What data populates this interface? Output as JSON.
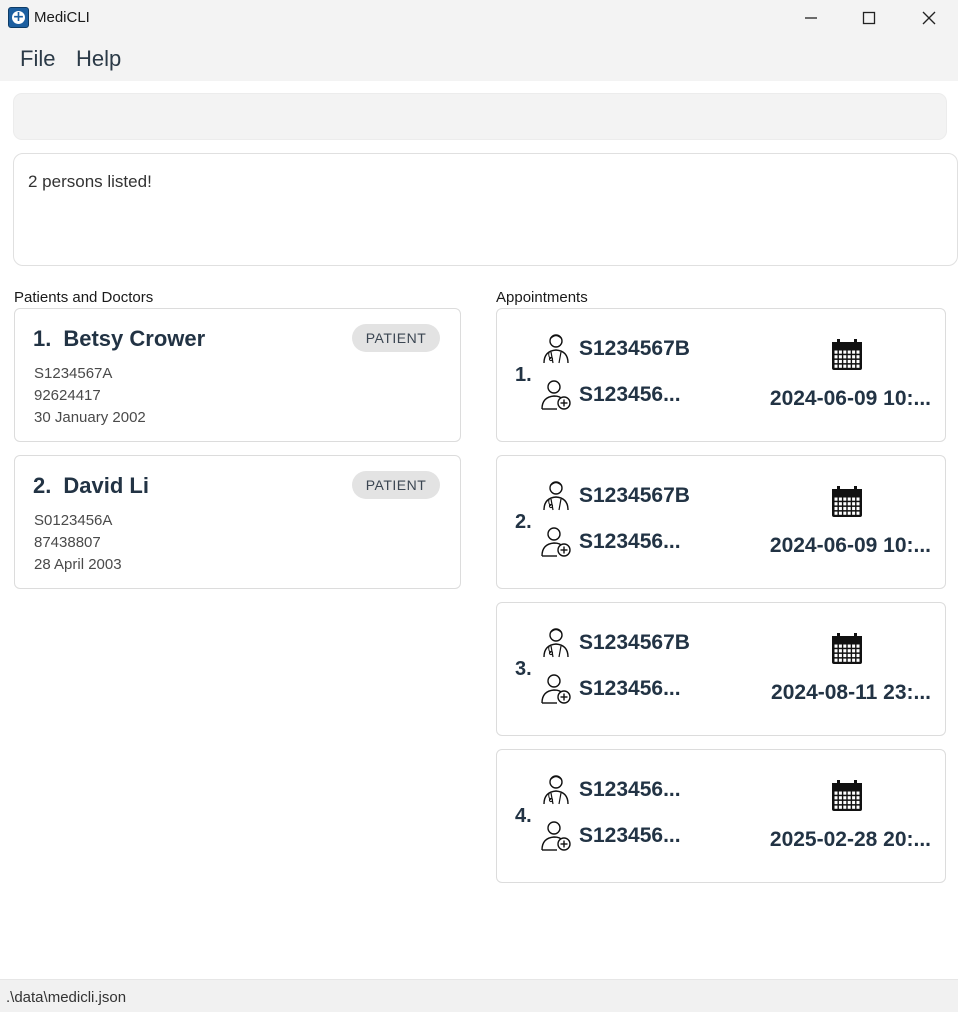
{
  "window": {
    "title": "MediCLI",
    "minimize_icon": "minimize-icon",
    "maximize_icon": "maximize-icon",
    "close_icon": "close-icon"
  },
  "menu": {
    "file_label": "File",
    "help_label": "Help"
  },
  "command": {
    "value": "",
    "placeholder": ""
  },
  "result": {
    "message": "2 persons listed!"
  },
  "persons_panel": {
    "label": "Patients and Doctors",
    "items": [
      {
        "index": "1.",
        "name": "Betsy Crower",
        "role": "PATIENT",
        "nric": "S1234567A",
        "phone": "92624417",
        "dob": "30 January 2002"
      },
      {
        "index": "2.",
        "name": "David Li",
        "role": "PATIENT",
        "nric": "S0123456A",
        "phone": "87438807",
        "dob": "28 April 2003"
      }
    ]
  },
  "appointments_panel": {
    "label": "Appointments",
    "items": [
      {
        "index": "1.",
        "doctor_id": "S1234567B",
        "patient_id": "S123456...",
        "datetime": "2024-06-09 10:..."
      },
      {
        "index": "2.",
        "doctor_id": "S1234567B",
        "patient_id": "S123456...",
        "datetime": "2024-06-09 10:..."
      },
      {
        "index": "3.",
        "doctor_id": "S1234567B",
        "patient_id": "S123456...",
        "datetime": "2024-08-11 23:..."
      },
      {
        "index": "4.",
        "doctor_id": "S123456...",
        "patient_id": "S123456...",
        "datetime": "2025-02-28 20:..."
      }
    ]
  },
  "status": {
    "file_path": ".\\data\\medicli.json"
  },
  "colors": {
    "accent": "#223344",
    "badge_bg": "#e3e3e3",
    "app_icon": "#1c5fa0"
  }
}
